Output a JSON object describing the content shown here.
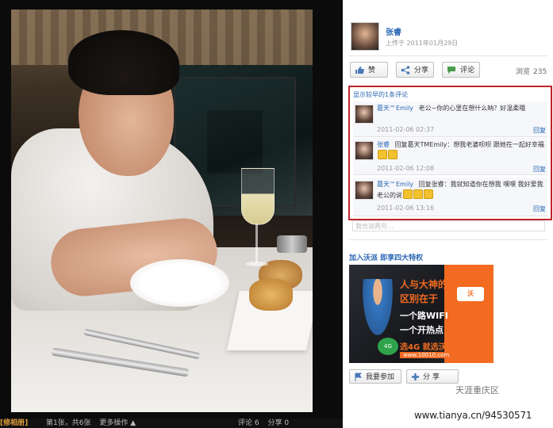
{
  "panel": {
    "username": "张睿",
    "upload_date": "上传于 2011年01月29日",
    "buttons": {
      "like": "赞",
      "share": "分享",
      "comment": "评论"
    },
    "views_label": "浏览",
    "views_count": "235",
    "show_earlier": "显示较早的1条评论",
    "comments": [
      {
        "author": "葛天™Emily",
        "text": "老公~你的心里在想什么呐？好温柔哦",
        "time": "2011-02-06 02:37",
        "reply": "回复"
      },
      {
        "author": "张睿",
        "text": "回复葛天TMEmily：想我老婆呗呗 跟她在一起好幸福",
        "time": "2011-02-06 12:08",
        "reply": "回复"
      },
      {
        "author": "葛天™Emily",
        "text": "回复张睿：我就知道你在想我 嘿嘿 我好爱我老公的说",
        "time": "2011-02-06 13:16",
        "reply": "回复"
      }
    ],
    "comment_input_placeholder": "我也说两句..."
  },
  "ad": {
    "title": "加入沃派 即享四大特权",
    "line1": "人与大神的",
    "line2": "区别在于",
    "line3": "一个路WIFI",
    "line4": "一个开热点",
    "brand": "沃",
    "slogan": "选4G 就选沃",
    "url": "www.10010.com",
    "join_button": "我要参加",
    "share_button": "分 享"
  },
  "viewer_bar": {
    "album": "[修相册]",
    "counter": "第1张，共6张",
    "more": "更多操作 ▲",
    "comments": "评论  6",
    "share": "分享  0"
  },
  "watermark": "天涯重庆区",
  "footer_url": "www.tianya.cn/94530571",
  "colors": {
    "link": "#2866b3",
    "highlight_border": "#c0232d",
    "ad_accent": "#f26b21"
  }
}
